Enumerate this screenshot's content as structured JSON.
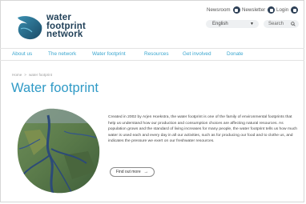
{
  "header": {
    "logo_lines": [
      "water",
      "footprint",
      "network"
    ],
    "newsroom_label": "Newsroom",
    "newsletter_label": "Newsletter",
    "login_label": "Login",
    "language": {
      "selected": "English"
    },
    "search": {
      "placeholder": "Search"
    }
  },
  "nav": {
    "items": [
      {
        "label": "About us"
      },
      {
        "label": "The network"
      },
      {
        "label": "Water footprint"
      },
      {
        "label": "Resources"
      },
      {
        "label": "Get involved"
      },
      {
        "label": "Donate"
      }
    ]
  },
  "breadcrumb": {
    "home": "Home",
    "separator": ">",
    "current": "water footprint"
  },
  "main": {
    "title": "Water footprint",
    "body": "Created in 2002 by Arjen Hoekstra, the water footprint is one of the family of environmental footprints that help us understand how our production and consumption choices are affecting natural resources. As population grows and the standard of living increases for many people, the water footprint tells us how much water is used each and every day in all our activities, such as for producing our food and to clothe us, and indicates the pressure we exert on our freshwater resources.",
    "cta_label": "Find out more",
    "cta_arrow": "→"
  },
  "colors": {
    "accent": "#2f9ac6",
    "nav": "#3aa6cf",
    "brand_dark": "#1f3f57"
  }
}
